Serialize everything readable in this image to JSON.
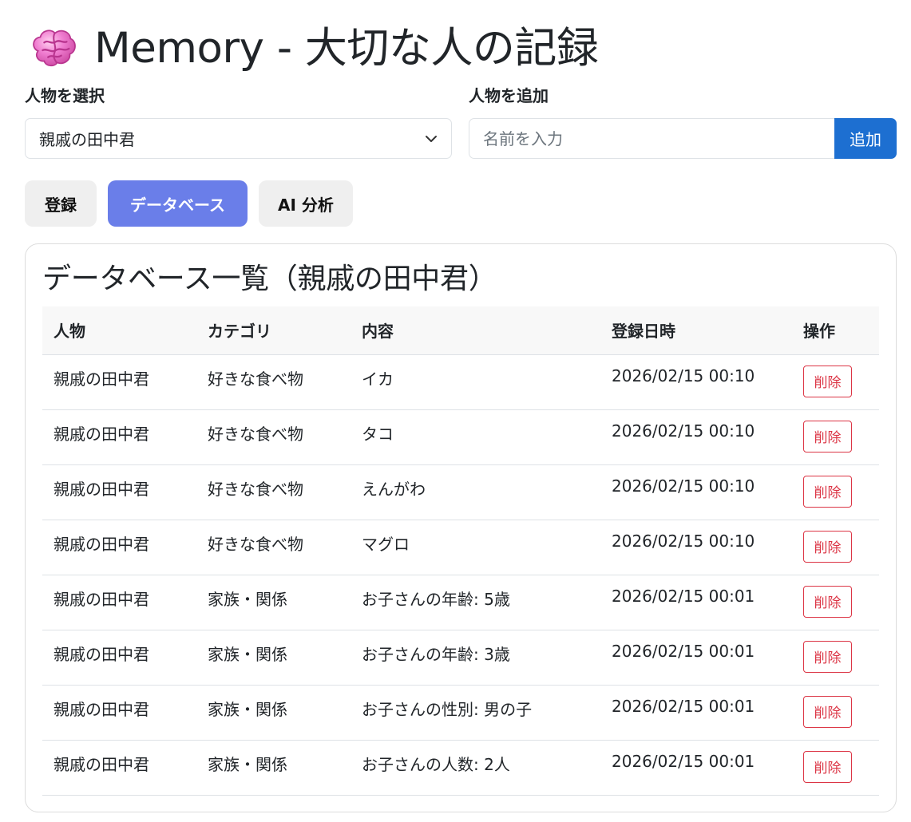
{
  "app": {
    "title": "Memory - 大切な人の記録",
    "icon": "brain-icon"
  },
  "person_select": {
    "label": "人物を選択",
    "selected_value": "親戚の田中君"
  },
  "person_add": {
    "label": "人物を追加",
    "placeholder": "名前を入力",
    "button_label": "追加"
  },
  "tabs": [
    {
      "label": "登録",
      "active": false
    },
    {
      "label": "データベース",
      "active": true
    },
    {
      "label": "AI 分析",
      "active": false
    }
  ],
  "database": {
    "title": "データベース一覧（親戚の田中君）",
    "columns": [
      "人物",
      "カテゴリ",
      "内容",
      "登録日時",
      "操作"
    ],
    "delete_label": "削除",
    "rows": [
      {
        "person": "親戚の田中君",
        "category": "好きな食べ物",
        "content": "イカ",
        "registered": "2026/02/15 00:10"
      },
      {
        "person": "親戚の田中君",
        "category": "好きな食べ物",
        "content": "タコ",
        "registered": "2026/02/15 00:10"
      },
      {
        "person": "親戚の田中君",
        "category": "好きな食べ物",
        "content": "えんがわ",
        "registered": "2026/02/15 00:10"
      },
      {
        "person": "親戚の田中君",
        "category": "好きな食べ物",
        "content": "マグロ",
        "registered": "2026/02/15 00:10"
      },
      {
        "person": "親戚の田中君",
        "category": "家族・関係",
        "content": "お子さんの年齢: 5歳",
        "registered": "2026/02/15 00:01"
      },
      {
        "person": "親戚の田中君",
        "category": "家族・関係",
        "content": "お子さんの年齢: 3歳",
        "registered": "2026/02/15 00:01"
      },
      {
        "person": "親戚の田中君",
        "category": "家族・関係",
        "content": "お子さんの性別: 男の子",
        "registered": "2026/02/15 00:01"
      },
      {
        "person": "親戚の田中君",
        "category": "家族・関係",
        "content": "お子さんの人数: 2人",
        "registered": "2026/02/15 00:01"
      }
    ]
  },
  "colors": {
    "primary": "#1d6fd1",
    "active_tab": "#6a7ee9",
    "danger": "#dc3545",
    "brain": "#f070c8"
  }
}
